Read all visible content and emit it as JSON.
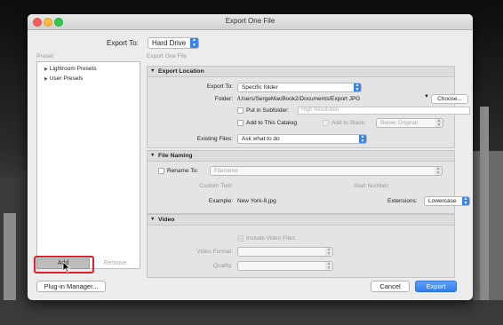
{
  "window": {
    "title": "Export One File"
  },
  "export_to": {
    "label": "Export To:",
    "value": "Hard Drive"
  },
  "presets": {
    "label": "Preset:",
    "items": [
      {
        "label": "Lightroom Presets"
      },
      {
        "label": "User Presets"
      }
    ],
    "add_label": "Add",
    "remove_label": "Remove"
  },
  "panel_title": "Export One File",
  "export_location": {
    "header": "Export Location",
    "export_to_label": "Export To:",
    "export_to_value": "Specific folder",
    "folder_label": "Folder:",
    "folder_path": "/Users/SergeMacBook2/Documents/Export JPG",
    "choose_label": "Choose...",
    "subfolder_label": "Put in Subfolder:",
    "subfolder_placeholder": "High Resolution",
    "add_catalog_label": "Add to This Catalog",
    "add_stack_label": "Add to Stack:",
    "stack_value": "Below Original",
    "existing_files_label": "Existing Files:",
    "existing_files_value": "Ask what to do"
  },
  "file_naming": {
    "header": "File Naming",
    "rename_label": "Rename To:",
    "rename_value": "Filename",
    "custom_text_label": "Custom Text:",
    "start_number_label": "Start Number:",
    "example_label": "Example:",
    "example_value": "New York-8.jpg",
    "extensions_label": "Extensions:",
    "extensions_value": "Lowercase"
  },
  "video": {
    "header": "Video",
    "include_label": "Include Video Files:",
    "format_label": "Video Format:",
    "quality_label": "Quality:"
  },
  "footer": {
    "plugin_manager": "Plug-in Manager...",
    "cancel": "Cancel",
    "export": "Export"
  }
}
